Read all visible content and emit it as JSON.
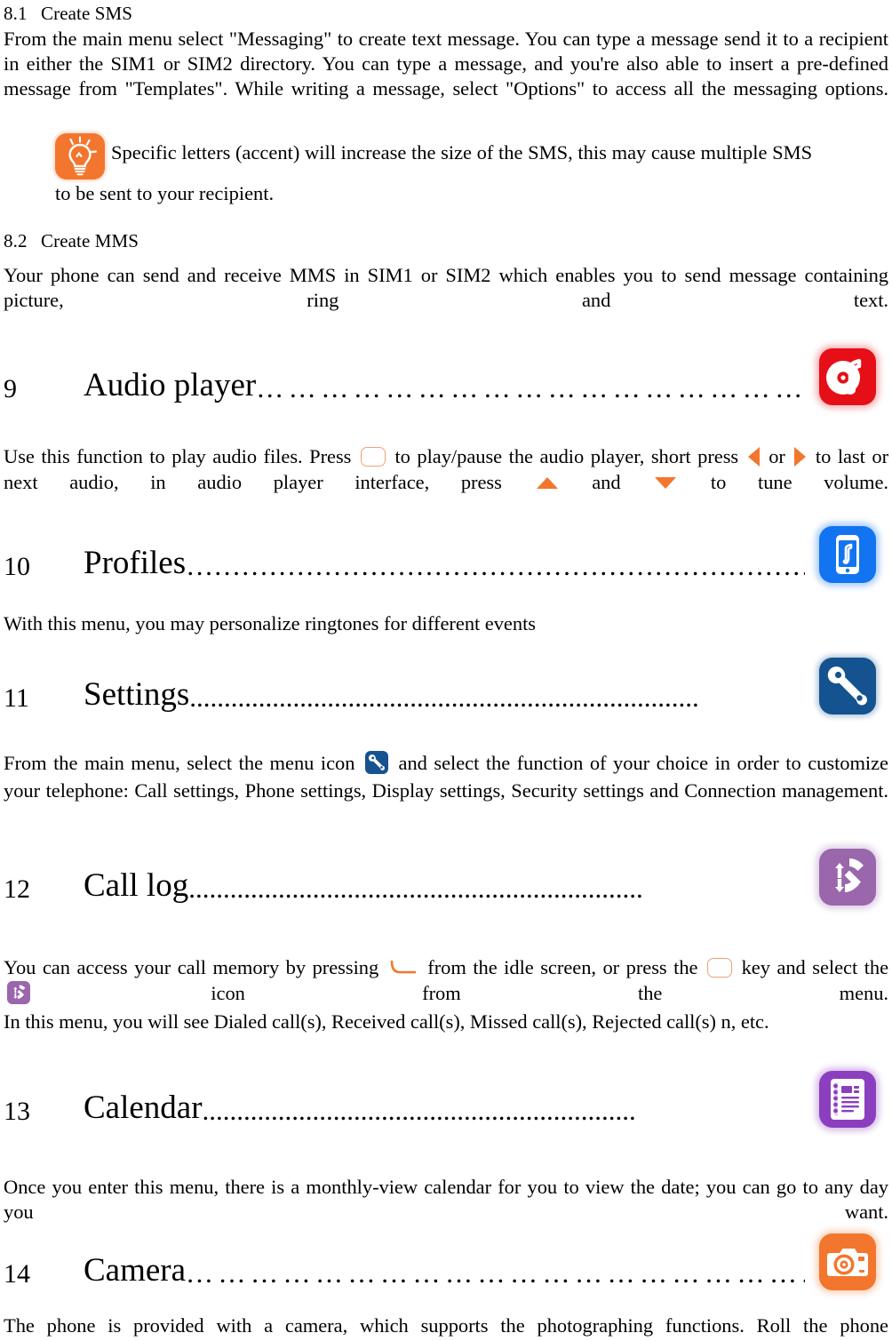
{
  "document": {
    "type": "mobile-phone-user-manual-page",
    "sections": [
      {
        "number": "8.1",
        "title": "Create SMS"
      },
      {
        "number": "8.2",
        "title": "Create MMS"
      }
    ]
  },
  "sms": {
    "heading_number": "8.1",
    "heading_title": "Create SMS",
    "body": "From the main menu select \"Messaging\" to create text message. You can type a message send it to a recipient in either the SIM1 or SIM2 directory. You can type a message, and you're also able to insert a pre-defined message from \"Templates\". While writing a message, select \"Options\" to access all the messaging options.",
    "tip_line1": "Specific letters (accent) will increase the size of the SMS, this may cause multiple SMS",
    "tip_line2": "to be sent to your recipient.",
    "tip_icon": "lightbulb-tip-icon"
  },
  "mms": {
    "heading_number": "8.2",
    "heading_title": "Create MMS",
    "body": "Your phone can send and receive MMS in SIM1 or SIM2 which enables you to send message containing picture, ring and text."
  },
  "audio_player": {
    "number": "9",
    "title": "Audio player",
    "leader": "……………………………………………",
    "icon": "audio-player-icon",
    "body_1": "Use this function to play audio files. Press",
    "body_2": "to play/pause the audio player, short press",
    "body_3": "or",
    "body_4": "to last or next audio, in audio player interface, press",
    "body_5": "and",
    "body_6": "to tune volume.",
    "glyph_ok": "ok-key-glyph",
    "glyph_left": "left-arrow-glyph",
    "glyph_right": "right-arrow-glyph",
    "glyph_up": "up-arrow-glyph",
    "glyph_down": "down-arrow-glyph"
  },
  "profiles": {
    "number": "10",
    "title": "Profiles",
    "leader": "…………………………………………………………………………………...",
    "icon": "profiles-icon",
    "body": "With this menu, you may personalize ringtones for different events"
  },
  "settings": {
    "number": "11",
    "title": "Settings",
    "leader": "..........................................................................",
    "icon": "settings-wrench-icon",
    "body_1": "From the main menu, select the menu icon",
    "body_2": "and select the function of your choice in order to customize your telephone: Call settings, Phone settings, Display settings, Security settings and Connection management.",
    "inline_icon": "settings-wrench-inline-icon"
  },
  "call_log": {
    "number": "12",
    "title": "Call log",
    "leader": "..................................................................",
    "icon": "call-log-icon",
    "body_1": "You can access your call memory by pressing",
    "body_2": "from the idle screen, or press the",
    "body_3": "key and select the",
    "body_4": "icon from the menu.",
    "body_5": "In this menu, you will see Dialed call(s), Received call(s), Missed call(s), Rejected call(s) n, etc.",
    "glyph_send": "send-call-key-glyph",
    "glyph_ok": "ok-key-glyph",
    "inline_icon": "call-log-inline-icon"
  },
  "calendar": {
    "number": "13",
    "title": "Calendar",
    "leader": "...............................................................",
    "icon": "calendar-notepad-icon",
    "body": "Once you enter this menu, there is a monthly-view calendar for you to view the date; you can go to any day you want."
  },
  "camera": {
    "number": "14",
    "title": "Camera",
    "leader": "…………………………………………………..",
    "icon": "camera-icon",
    "body": "The phone is provided with a camera, which supports the photographing functions. Roll the phone"
  },
  "colors": {
    "accent_orange": "#f2762e",
    "audio_red": "#e60f18",
    "profiles_blue": "#1274f0",
    "settings_navy": "#14538f",
    "call_log_purple": "#9a66ac",
    "calendar_violet": "#8b3fbe",
    "camera_orange": "#f2762e",
    "text": "#000000",
    "page_background": "#ffffff"
  }
}
